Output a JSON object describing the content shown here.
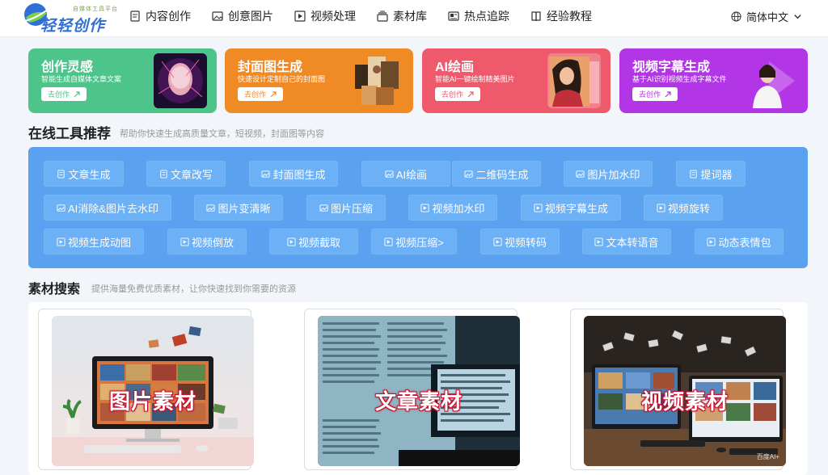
{
  "header": {
    "logo_text": "轻轻创作",
    "logo_sub": "自媒体工具平台",
    "nav": [
      {
        "label": "内容创作",
        "icon": "document-icon"
      },
      {
        "label": "创意图片",
        "icon": "image-icon"
      },
      {
        "label": "视频处理",
        "icon": "video-icon"
      },
      {
        "label": "素材库",
        "icon": "stack-icon"
      },
      {
        "label": "热点追踪",
        "icon": "news-icon"
      },
      {
        "label": "经验教程",
        "icon": "book-icon"
      }
    ],
    "language": "简体中文"
  },
  "cards": [
    {
      "title": "创作灵感",
      "desc": "智能生成自媒体文章文案",
      "button": "去创作",
      "color": "#4cc48a"
    },
    {
      "title": "封面图生成",
      "desc": "快速设计定制自己的封面图",
      "button": "去创作",
      "color": "#f08a24"
    },
    {
      "title": "AI绘画",
      "desc": "智能AI一键绘制精美图片",
      "button": "去创作",
      "color": "#ee5a6c"
    },
    {
      "title": "视频字幕生成",
      "desc": "基于AI识别视频生成字幕文件",
      "button": "去创作",
      "color": "#b236e6"
    }
  ],
  "tools_section": {
    "title": "在线工具推荐",
    "subtitle": "帮助你快速生成高质量文章，短视频，封面图等内容"
  },
  "tools": [
    [
      "文章生成",
      "文章改写",
      "封面图生成",
      "AI绘画",
      "二维码生成",
      "图片加水印",
      "提词器"
    ],
    [
      "AI消除&图片去水印",
      "图片变清晰",
      "图片压缩",
      "视频加水印",
      "视频字幕生成",
      "视频旋转"
    ],
    [
      "视频生成动图",
      "视频倒放",
      "视频截取",
      "视频压缩>",
      "视频转码",
      "文本转语音",
      "动态表情包"
    ]
  ],
  "materials_section": {
    "title": "素材搜索",
    "subtitle": "提供海量免费优质素材，让你快速找到你需要的资源"
  },
  "materials": [
    {
      "label": "图片素材"
    },
    {
      "label": "文章素材"
    },
    {
      "label": "视频素材",
      "watermark": "百度AI+"
    }
  ],
  "colors": {
    "tools_bg": "#5aa1f0",
    "tool_btn": "#6cb0f6",
    "material_label_outline": "#c8102e"
  }
}
